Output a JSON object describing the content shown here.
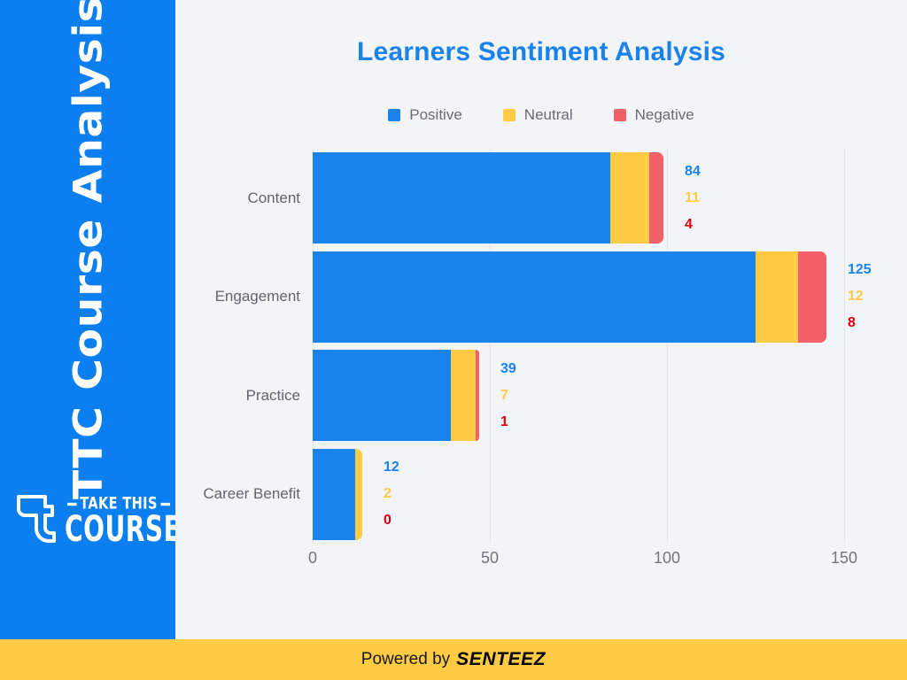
{
  "sidebar": {
    "title": "TTC Course Analysis",
    "logo": {
      "line1": "TAKE THIS",
      "line2": "COURSE",
      "mark": "take-this-course-t-mark"
    },
    "bg_color": "#0b7ef0"
  },
  "chart": {
    "title": "Learners Sentiment Analysis",
    "title_color": "#1a82ed"
  },
  "legend": {
    "items": [
      {
        "label": "Positive",
        "color": "#1a82ed"
      },
      {
        "label": "Neutral",
        "color": "#ffca44"
      },
      {
        "label": "Negative",
        "color": "#f4606a"
      }
    ]
  },
  "footer": {
    "text": "Powered by",
    "brand": "SENTEEZ",
    "bg_color": "#ffca44"
  },
  "chart_data": {
    "type": "bar",
    "orientation": "horizontal",
    "stacked": true,
    "title": "Learners Sentiment Analysis",
    "xlabel": "",
    "ylabel": "",
    "categories": [
      "Content",
      "Engagement",
      "Practice",
      "Career Benefit"
    ],
    "series": [
      {
        "name": "Positive",
        "color": "#1a82ed",
        "values": [
          84,
          125,
          39,
          12
        ]
      },
      {
        "name": "Neutral",
        "color": "#ffca44",
        "values": [
          11,
          12,
          7,
          2
        ]
      },
      {
        "name": "Negative",
        "color": "#f4606a",
        "values": [
          4,
          8,
          1,
          0
        ]
      }
    ],
    "totals": [
      99,
      145,
      47,
      14
    ],
    "xlim": [
      0,
      160
    ],
    "xticks": [
      0,
      50,
      100,
      150
    ],
    "xticklabels": [
      "0",
      "50",
      "100",
      "150"
    ],
    "grid": true,
    "legend_position": "top-center",
    "data_labels": [
      {
        "category": "Content",
        "Positive": 84,
        "Neutral": 11,
        "Negative": 4
      },
      {
        "category": "Engagement",
        "Positive": 125,
        "Neutral": 12,
        "Negative": 8
      },
      {
        "category": "Practice",
        "Positive": 39,
        "Neutral": 7,
        "Negative": 1
      },
      {
        "category": "Career Benefit",
        "Positive": 12,
        "Neutral": 2,
        "Negative": 0
      }
    ]
  }
}
